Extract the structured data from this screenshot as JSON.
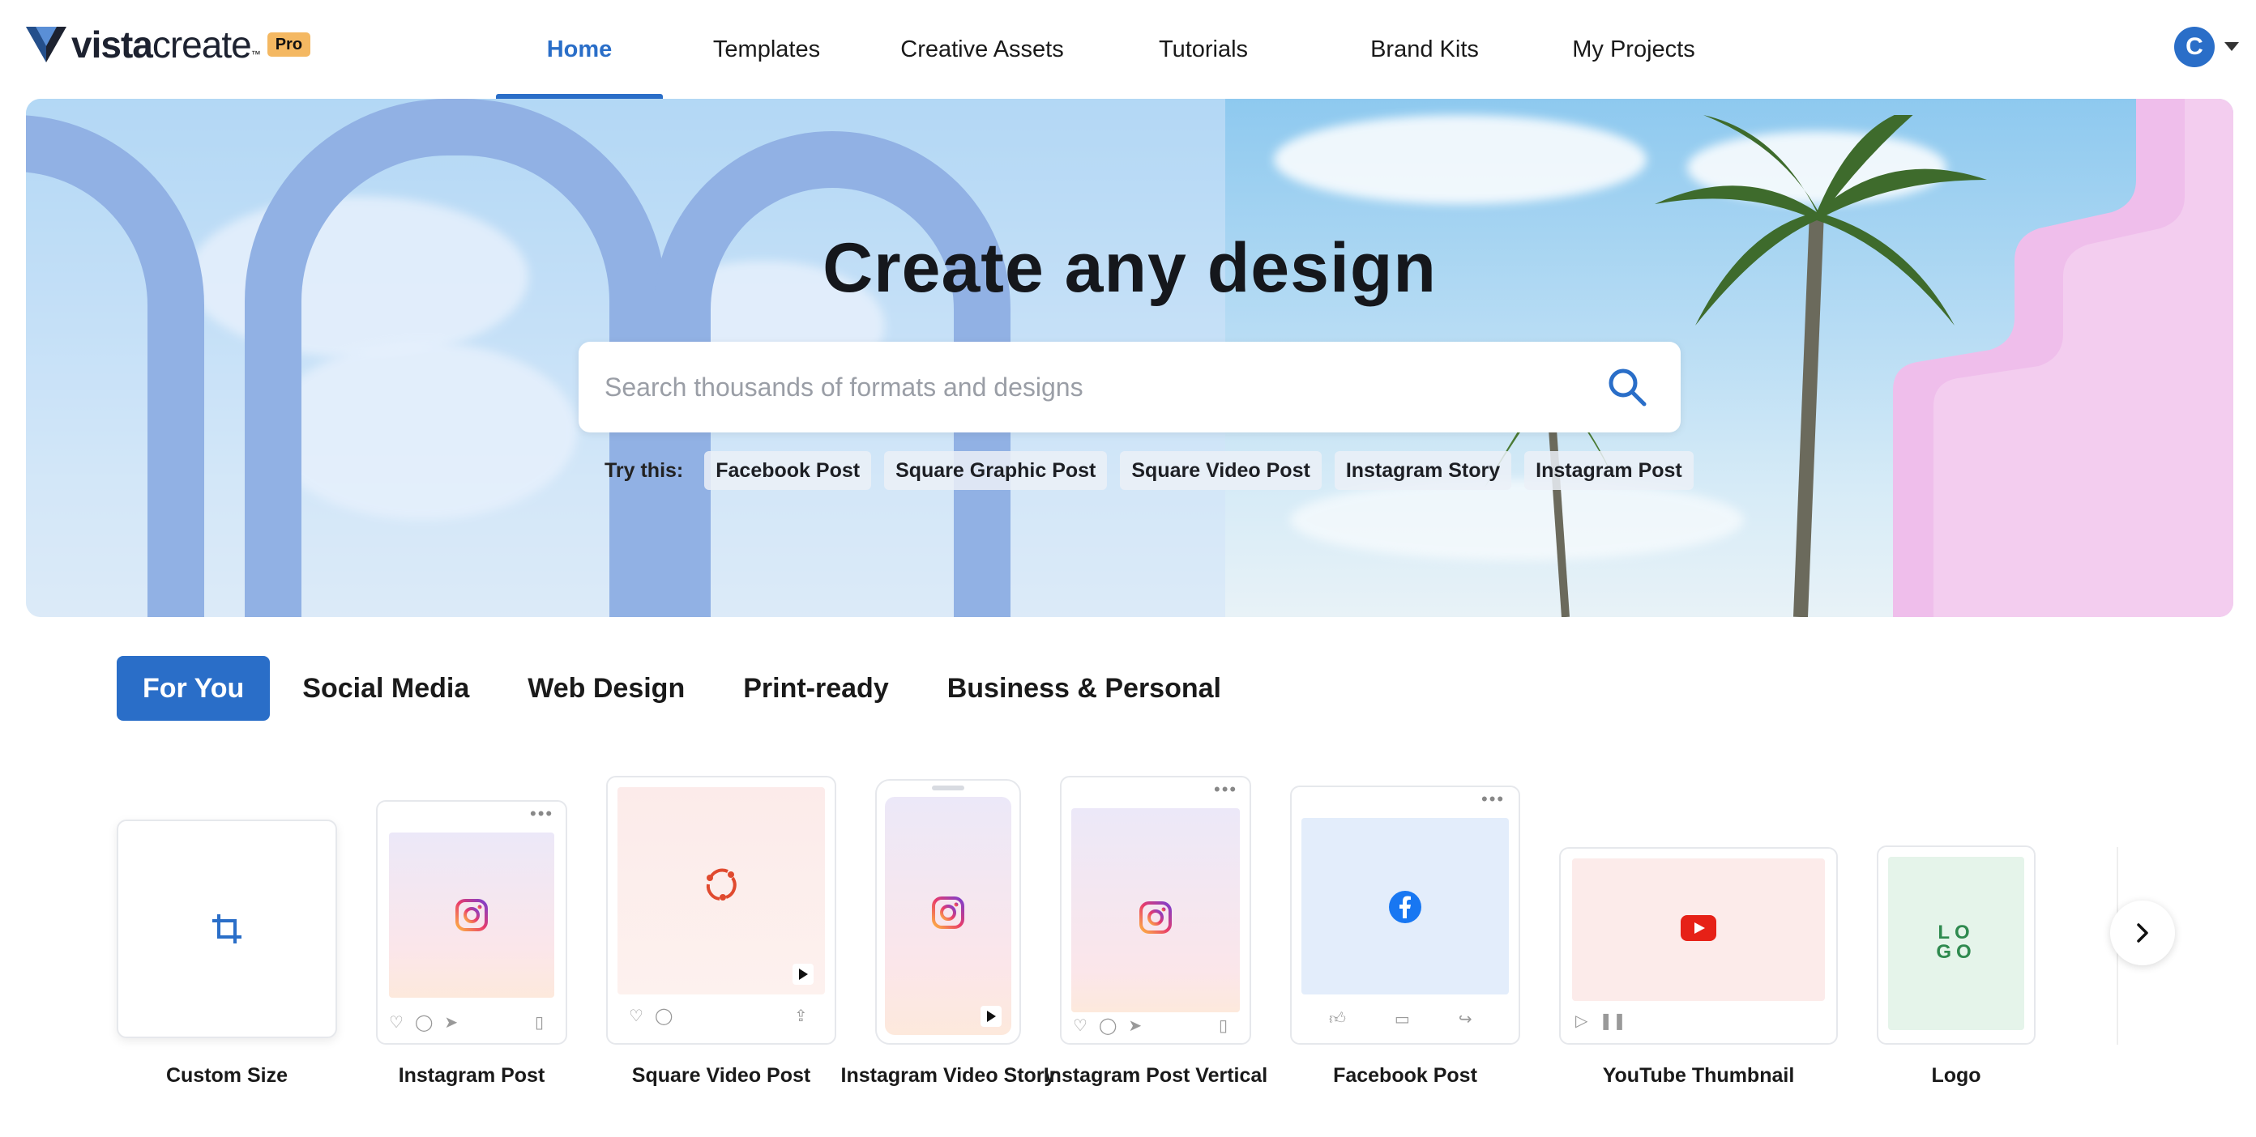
{
  "brand": {
    "name_bold": "vista",
    "name_light": "create",
    "tm": "™",
    "badge": "Pro"
  },
  "nav": [
    {
      "label": "Home",
      "active": true
    },
    {
      "label": "Templates"
    },
    {
      "label": "Creative Assets"
    },
    {
      "label": "Tutorials"
    },
    {
      "label": "Brand Kits"
    },
    {
      "label": "My Projects"
    }
  ],
  "user": {
    "initial": "C"
  },
  "hero": {
    "title": "Create any design",
    "search_placeholder": "Search thousands of formats and designs",
    "try_label": "Try this:",
    "chips": [
      "Facebook Post",
      "Square Graphic Post",
      "Square Video Post",
      "Instagram Story",
      "Instagram Post"
    ]
  },
  "tabs": [
    {
      "label": "For You",
      "active": true
    },
    {
      "label": "Social Media"
    },
    {
      "label": "Web Design"
    },
    {
      "label": "Print-ready"
    },
    {
      "label": "Business & Personal"
    }
  ],
  "formats": [
    {
      "label": "Custom Size",
      "icon": "crop-icon"
    },
    {
      "label": "Instagram Post",
      "icon": "instagram-icon"
    },
    {
      "label": "Square Video Post",
      "icon": "share-icon"
    },
    {
      "label": "Instagram Video Story",
      "icon": "instagram-icon"
    },
    {
      "label": "Instagram Post Vertical",
      "icon": "instagram-icon"
    },
    {
      "label": "Facebook Post",
      "icon": "facebook-icon"
    },
    {
      "label": "YouTube Thumbnail",
      "icon": "youtube-icon"
    },
    {
      "label": "Logo",
      "icon": "logo-icon",
      "logo_text_1": "LO",
      "logo_text_2": "GO"
    }
  ],
  "colors": {
    "accent": "#2a6ec8",
    "pro_badge": "#f4b862",
    "arch": "#91b1e4",
    "pink": "#e9b4e3"
  }
}
